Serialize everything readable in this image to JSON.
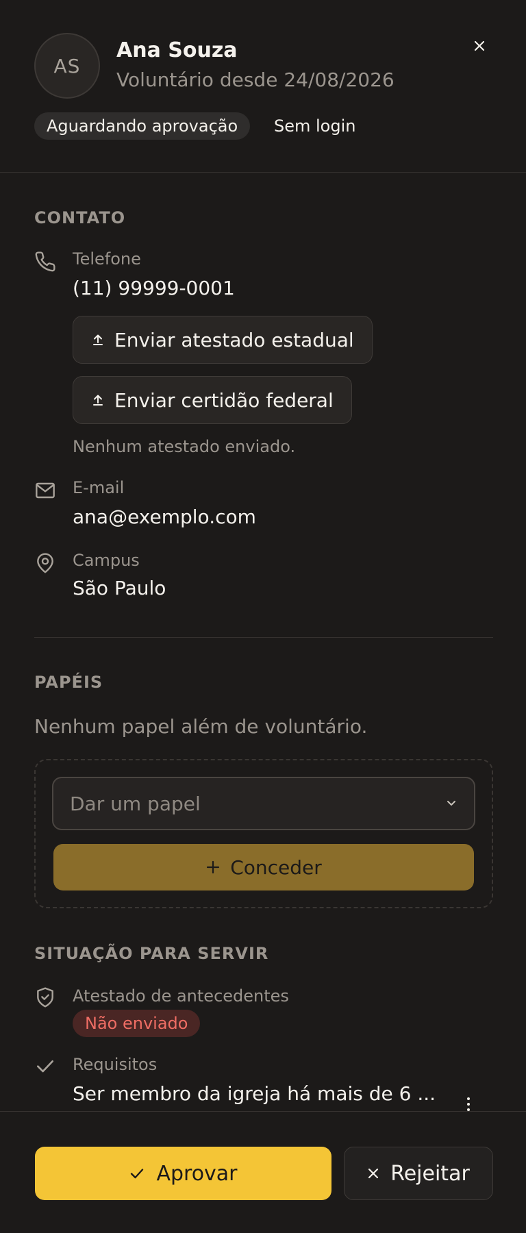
{
  "header": {
    "avatar_initials": "AS",
    "name": "Ana Souza",
    "since": "Voluntário desde 24/08/2026",
    "status_badge": "Aguardando aprovação",
    "login_badge": "Sem login",
    "close_icon": "close-icon"
  },
  "contact": {
    "title": "CONTATO",
    "phone_label": "Telefone",
    "phone_value": "(11) 99999-0001",
    "upload_state_label": "Enviar atestado estadual",
    "upload_federal_label": "Enviar certidão federal",
    "no_certificate": "Nenhum atestado enviado.",
    "email_label": "E-mail",
    "email_value": "ana@exemplo.com",
    "campus_label": "Campus",
    "campus_value": "São Paulo"
  },
  "roles": {
    "title": "PAPÉIS",
    "empty": "Nenhum papel além de voluntário.",
    "select_placeholder": "Dar um papel",
    "grant_label": "Conceder"
  },
  "serve_status": {
    "title": "SITUAÇÃO PARA SERVIR",
    "background_check_label": "Atestado de antecedentes",
    "background_check_status": "Não enviado",
    "requirements_label": "Requisitos",
    "requirements_value": "Ser membro da igreja há mais de 6 ..."
  },
  "footer": {
    "approve_label": "Aprovar",
    "reject_label": "Rejeitar"
  },
  "colors": {
    "background": "#1c1a19",
    "accent": "#f4c536",
    "accent_muted": "#8a6d2a",
    "danger_text": "#ef6d64",
    "danger_bg": "#4a2624"
  }
}
